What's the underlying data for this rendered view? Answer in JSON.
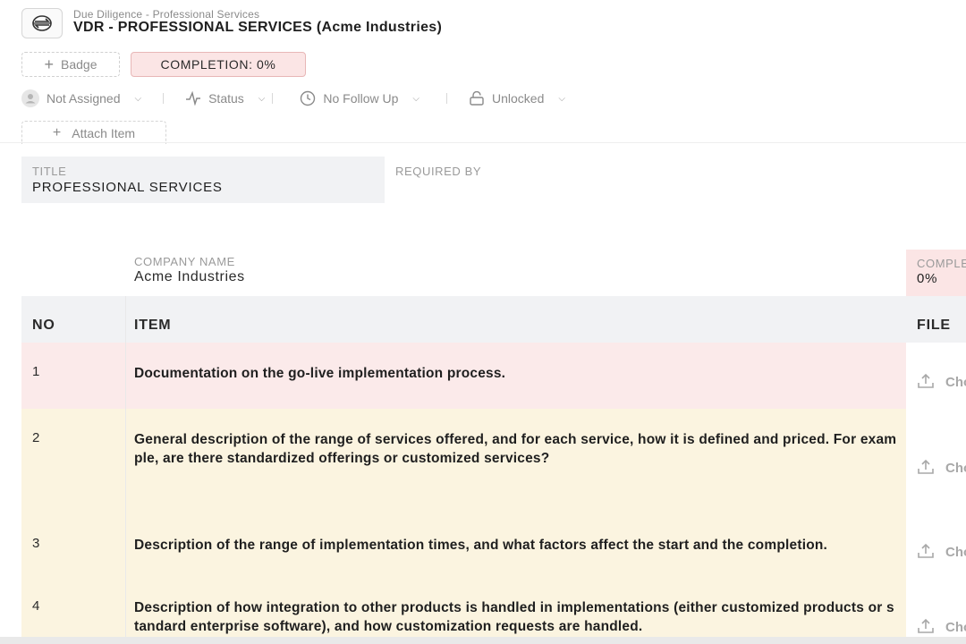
{
  "header": {
    "breadcrumb": "Due Diligence - Professional Services",
    "title": "VDR - PROFESSIONAL SERVICES (Acme Industries)",
    "badge_label": "Badge",
    "completion_label": "COMPLETION: 0%"
  },
  "filters": {
    "assignee": "Not Assigned",
    "status": "Status",
    "follow_up": "No Follow Up",
    "lock": "Unlocked"
  },
  "attach_label": "Attach Item",
  "fields": {
    "title_label": "TITLE",
    "title_value": "PROFESSIONAL SERVICES",
    "required_by_label": "REQUIRED BY",
    "required_by_value": ""
  },
  "company": {
    "label": "COMPANY NAME",
    "value": "Acme Industries",
    "completion_label": "COMPLETION",
    "completion_value": "0%"
  },
  "table": {
    "headers": {
      "no": "NO",
      "item": "ITEM",
      "file": "FILE"
    },
    "file_action": "Choose",
    "rows": [
      {
        "no": "1",
        "item": "Documentation on the go-live implementation process.",
        "bg": "#fbeaea"
      },
      {
        "no": "2",
        "item": "General description of the range of services offered, and for each service, how it is defined and priced. For example, are there standardized offerings or customized services?",
        "bg": "#fbf4e0"
      },
      {
        "no": "3",
        "item": "Description of the range of implementation times, and what factors affect the start and the completion.",
        "bg": "#fbf4e0"
      },
      {
        "no": "4",
        "item": "Description of how integration to other products is handled in implementations (either customized products or standard enterprise software), and how customization requests are handled.",
        "bg": "#fbf4e0"
      }
    ]
  },
  "icons": {
    "logo": "swap-logo-icon",
    "assignee": "user-avatar-icon",
    "status": "activity-icon",
    "follow_up": "clock-icon",
    "lock": "unlock-icon",
    "upload": "upload-icon"
  },
  "colors": {
    "completion_bg": "#fbe5e5",
    "row_pink": "#fbeaea",
    "row_yellow": "#fbf4e0",
    "header_grey": "#f1f2f4"
  }
}
